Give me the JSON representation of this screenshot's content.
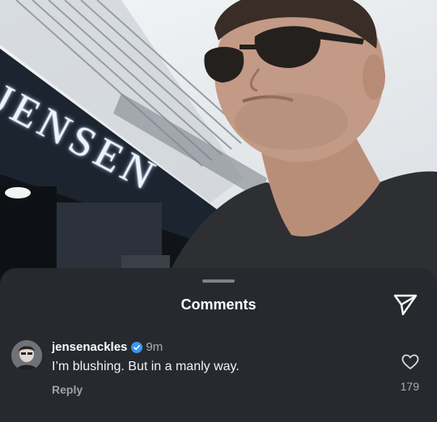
{
  "photo": {
    "sign_text": "JENSEN"
  },
  "sheet": {
    "title": "Comments",
    "share_icon": "paper-plane-icon"
  },
  "comments": [
    {
      "username": "jensenackles",
      "verified": true,
      "verified_color": "#3897f0",
      "time": "9m",
      "text": "I’m blushing.  But in a manly way.",
      "reply_label": "Reply",
      "like_icon": "heart-outline-icon",
      "like_count": "179"
    }
  ],
  "colors": {
    "sheet_background": "#262a2f",
    "text_primary": "#ffffff",
    "text_secondary": "#a7acb2"
  }
}
